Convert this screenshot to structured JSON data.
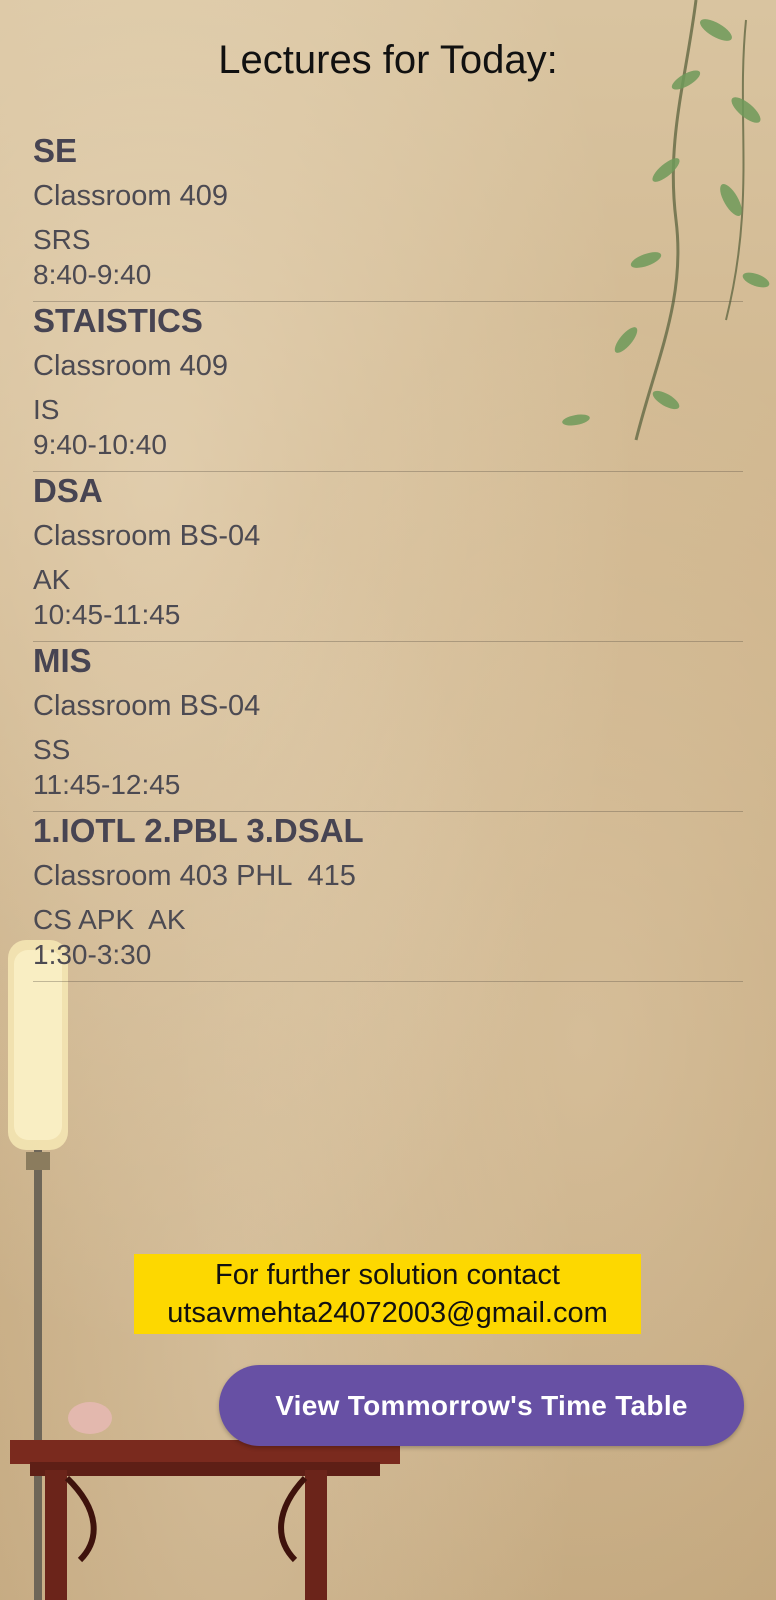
{
  "header": {
    "title": "Lectures for Today:"
  },
  "lectures": [
    {
      "subject": "SE",
      "room": "Classroom 409",
      "teacher": "SRS",
      "time": "8:40-9:40"
    },
    {
      "subject": "STAISTICS",
      "room": "Classroom 409",
      "teacher": "IS",
      "time": "9:40-10:40"
    },
    {
      "subject": "DSA",
      "room": "Classroom BS-04",
      "teacher": "AK",
      "time": "10:45-11:45"
    },
    {
      "subject": "MIS",
      "room": "Classroom BS-04",
      "teacher": "SS",
      "time": "11:45-12:45"
    },
    {
      "subject": "1.IOTL 2.PBL 3.DSAL",
      "room": "Classroom 403 PHL  415",
      "teacher": "CS APK  AK",
      "time": "1:30-3:30"
    }
  ],
  "contact": {
    "line1": "For further solution contact",
    "email": "utsavmehta24072003@gmail.com"
  },
  "actions": {
    "tomorrow_label": "View Tommorrow's Time Table"
  },
  "colors": {
    "accent": "#6750a4",
    "highlight": "#fdd800"
  }
}
